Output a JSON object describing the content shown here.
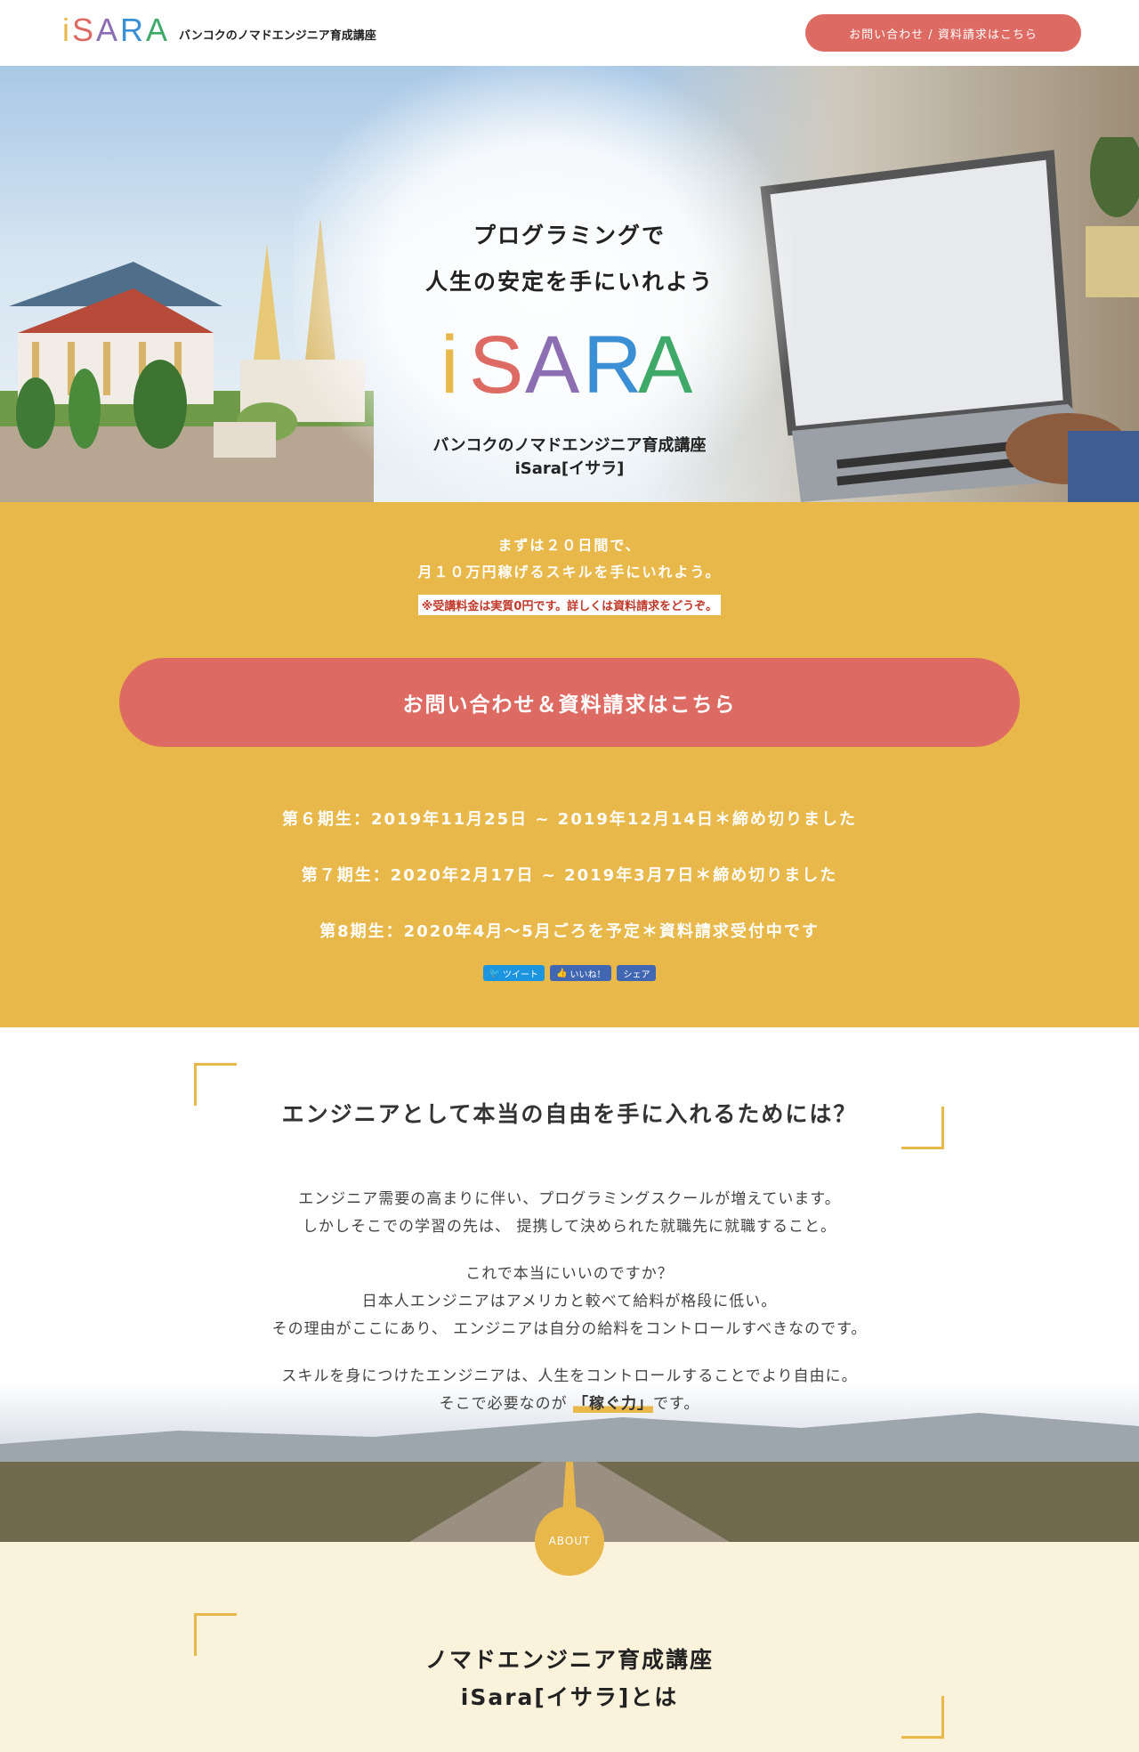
{
  "header": {
    "logo_letters": [
      "i",
      "S",
      "A",
      "R",
      "A"
    ],
    "logo_colors": [
      "#e9b84a",
      "#dd6b63",
      "#8c6fb3",
      "#3b8fd4",
      "#3fa96a"
    ],
    "subtitle": "バンコクのノマドエンジニア育成講座",
    "cta": "お問い合わせ / 資料請求はこちら"
  },
  "hero": {
    "line1": "プログラミングで",
    "line2": "人生の安定を手にいれよう",
    "logo_letters": [
      "i",
      "S",
      "A",
      "R",
      "A"
    ],
    "sub1": "バンコクのノマドエンジニア育成講座",
    "sub2": "iSara[イサラ]"
  },
  "cta_section": {
    "lead1": "まずは２０日間で、",
    "lead2": "月１０万円稼げるスキルを手にいれよう。",
    "note": "※受講料金は実質0円です。詳しくは資料請求をどうぞ。",
    "button": "お問い合わせ＆資料請求はこちら",
    "terms": [
      "第６期生：2019年11月25日 ~ 2019年12月14日＊締め切りました",
      "第７期生：2020年2月17日 ~ 2019年3月7日＊締め切りました",
      "第8期生：2020年4月〜5月ごろを予定＊資料請求受付中です"
    ],
    "share": {
      "tweet": "ツイート",
      "like": "いいね！",
      "share": "シェア"
    }
  },
  "freedom": {
    "title": "エンジニアとして本当の自由を手に入れるためには？",
    "p1_l1": "エンジニア需要の高まりに伴い、プログラミングスクールが増えています。",
    "p1_l2": "しかしそこでの学習の先は、 提携して決められた就職先に就職すること。",
    "p2_l1": "これで本当にいいのですか？",
    "p2_l2": "日本人エンジニアはアメリカと較べて給料が格段に低い。",
    "p2_l3": "その理由がここにあり、 エンジニアは自分の給料をコントロールすべきなのです。",
    "p3_l1": "スキルを身につけたエンジニアは、人生をコントロールすることでより自由に。",
    "p3_l2_pre": "そこで必要なのが ",
    "p3_l2_hl": "「稼ぐ力」",
    "p3_l2_post": "です。"
  },
  "about": {
    "badge": "ABOUT",
    "title1": "ノマドエンジニア育成講座",
    "title2": "iSara[イサラ]とは"
  },
  "colors": {
    "accent_yellow": "#e9b84a",
    "accent_red": "#dd6b63",
    "about_bg": "#fbf2dc"
  }
}
